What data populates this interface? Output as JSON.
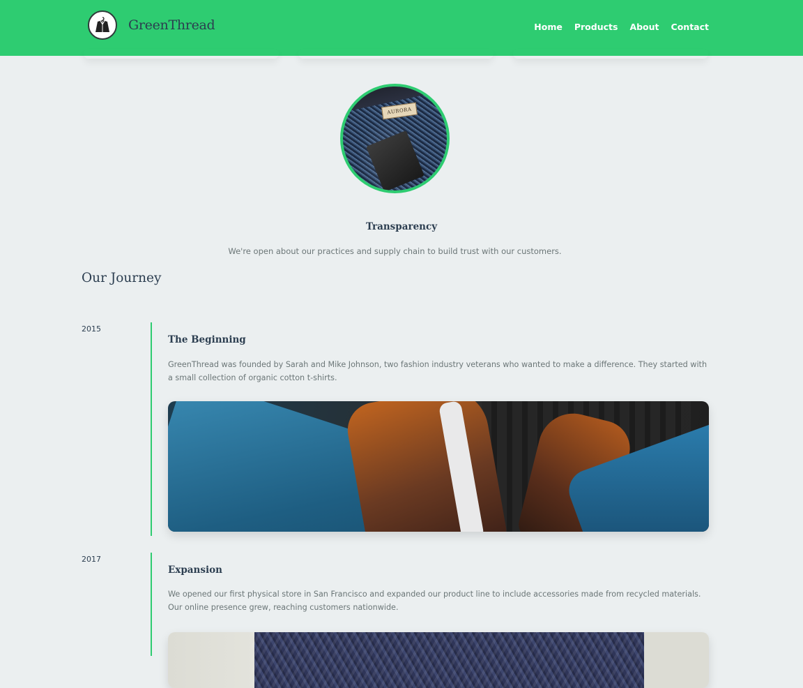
{
  "brand": {
    "name": "GreenThread",
    "logo_icon": "jacket-hanger-icon"
  },
  "nav": {
    "items": [
      "Home",
      "Products",
      "About",
      "Contact"
    ]
  },
  "colors": {
    "accent": "#2ecc71",
    "background": "#ebeff0",
    "text": "#2c3e50",
    "muted": "#6b7677"
  },
  "value": {
    "title": "Transparency",
    "description": "We're open about our practices and supply chain to build trust with our customers.",
    "image_tag": "AURORA"
  },
  "journey": {
    "heading": "Our Journey",
    "milestones": [
      {
        "year": "2015",
        "title": "The Beginning",
        "description": "GreenThread was founded by Sarah and Mike Johnson, two fashion industry veterans who wanted to make a difference. They started with a small collection of organic cotton t-shirts."
      },
      {
        "year": "2017",
        "title": "Expansion",
        "description": "We opened our first physical store in San Francisco and expanded our product line to include accessories made from recycled materials. Our online presence grew, reaching customers nationwide."
      }
    ]
  }
}
